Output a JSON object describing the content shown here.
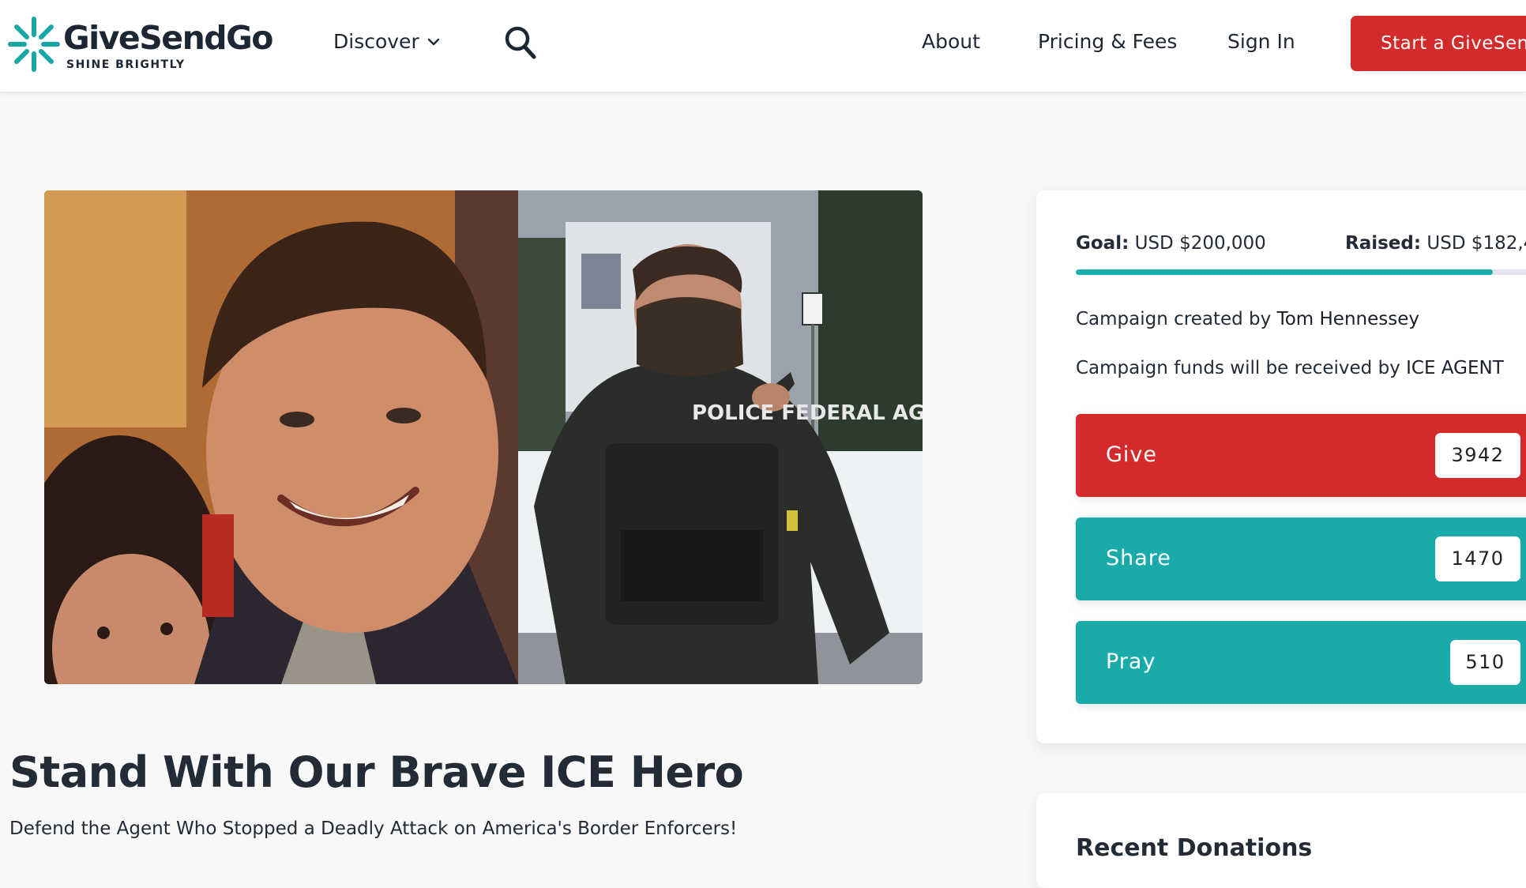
{
  "header": {
    "logo_name": "GiveSendGo",
    "logo_tagline": "SHINE BRIGHTLY",
    "nav": {
      "discover_label": "Discover",
      "about_label": "About",
      "pricing_label": "Pricing & Fees",
      "signin_label": "Sign In",
      "start_label": "Start a GiveSendGo"
    }
  },
  "campaign": {
    "title": "Stand With Our Brave ICE Hero",
    "subtitle": "Defend the Agent Who Stopped a Deadly Attack on America's Border Enforcers!",
    "image_badge_text": "POLICE FEDERAL AGENT"
  },
  "panel": {
    "goal_label": "Goal:",
    "goal_value": "USD $200,000",
    "raised_label": "Raised:",
    "raised_value": "USD $182,4",
    "progress_fraction": 0.91,
    "created_by_prefix": "Campaign created by",
    "created_by_name": "Tom Hennessey",
    "received_by_prefix": "Campaign funds will be received by",
    "received_by_name": "ICE AGENT",
    "actions": {
      "give_label": "Give",
      "give_count": "3942",
      "share_label": "Share",
      "share_count": "1470",
      "pray_label": "Pray",
      "pray_count": "510"
    },
    "recent_donations_title": "Recent Donations"
  },
  "colors": {
    "brand_red": "#d32b2b",
    "brand_teal": "#19aaa9",
    "logo_teal": "#19a6a6",
    "text_dark": "#222b36"
  },
  "icons": {
    "logo": "starburst-logo-icon",
    "discover_chevron": "chevron-down-icon",
    "search": "search-icon"
  }
}
